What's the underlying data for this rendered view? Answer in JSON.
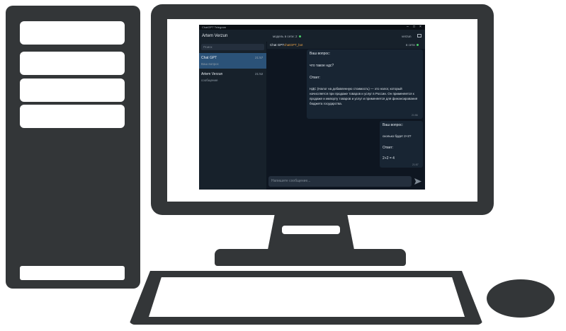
{
  "app": {
    "window_title": "ChatGPT Telegram",
    "window_controls": [
      "–",
      "□",
      "×"
    ],
    "user_name": "Artem Verzun",
    "header_sub": "модель в сети: 2",
    "header_right": "verzun",
    "search_placeholder": "Поиск",
    "chats": [
      {
        "name": "Chat GPT",
        "time": "21:57",
        "preview": "Ваш вопрос"
      },
      {
        "name": "Artem Verzun",
        "time": "21:52",
        "preview": "сообщение"
      }
    ],
    "chat_header": {
      "name": "Chat GPT",
      "bot": "chatGPT_bot",
      "status": "в сети"
    },
    "messages": [
      {
        "label": "Ваш вопрос:",
        "question": "что такое ндс?",
        "answer_label": "Ответ:",
        "answer": "НДС (Налог на добавленную стоимость) — это налог, который начисляется при продаже товаров и услуг в России. Он применяется к продаже и импорту товаров и услуг и применяется для финансирования бюджета государства.",
        "time": "21:56"
      },
      {
        "label": "Ваш вопрос:",
        "question": "сколько будет 2+2?",
        "answer_label": "Ответ:",
        "answer": "2+2 = 4",
        "time": "21:57"
      }
    ],
    "input_placeholder": "Напишите сообщение...",
    "colors": {
      "accent": "#2b5278",
      "bg": "#0e1621",
      "panel": "#17212b",
      "online": "#4bd06b",
      "bot": "#e8a34a"
    }
  }
}
